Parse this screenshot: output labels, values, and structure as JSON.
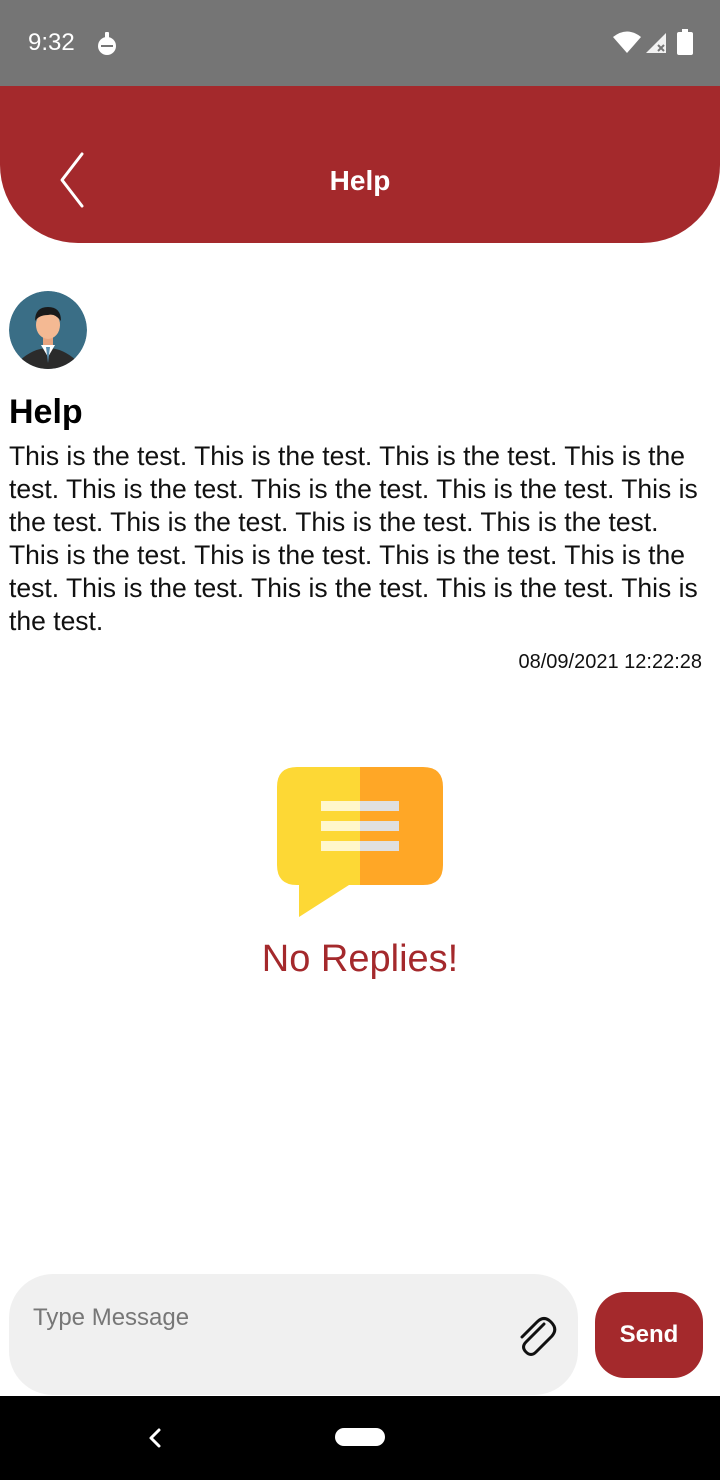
{
  "status_bar": {
    "time": "9:32",
    "icons": [
      "app-notification-icon",
      "wifi-icon",
      "signal-icon",
      "battery-icon"
    ]
  },
  "header": {
    "title": "Help",
    "back_icon": "chevron-left-icon",
    "background_color": "#a4292c"
  },
  "ticket": {
    "avatar_icon": "user-avatar-icon",
    "subject": "Help",
    "body": "This is the test. This is the test. This is the test. This is the test. This is the test. This is the test. This is the test. This is the test. This is the test. This is the test. This is the test. This is the test. This is the test. This is the test. This is the test. This is the test. This is the test. This is the test. This is the test.",
    "timestamp": "08/09/2021 12:22:28"
  },
  "empty_state": {
    "icon": "chat-bubble-icon",
    "text": "No Replies!"
  },
  "composer": {
    "placeholder": "Type Message",
    "value": "",
    "attach_icon": "paperclip-icon",
    "send_label": "Send"
  },
  "nav_bar": {
    "icons": [
      "nav-back-icon",
      "nav-home-icon"
    ]
  },
  "colors": {
    "accent": "#a4292c",
    "status_bar": "#757575",
    "composer_bg": "#f0f0f0",
    "bubble_left": "#fdd835",
    "bubble_right": "#ffa726"
  }
}
